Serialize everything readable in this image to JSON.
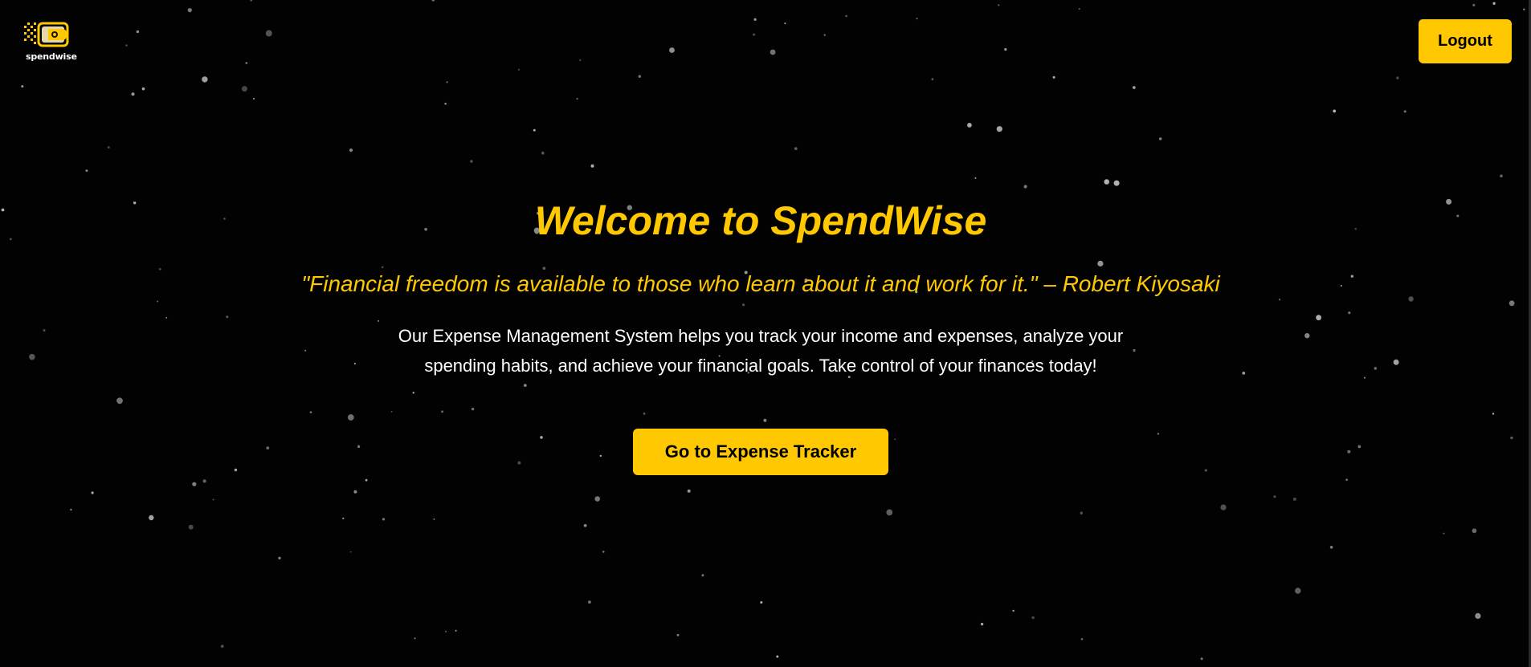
{
  "brand": {
    "name": "spendwise",
    "logo_icon": "wallet-icon"
  },
  "header": {
    "logout_label": "Logout"
  },
  "hero": {
    "title": "Welcome to SpendWise",
    "quote": "\"Financial freedom is available to those who learn about it and work for it.\" – Robert Kiyosaki",
    "description": "Our Expense Management System helps you track your income and expenses, analyze your spending habits, and achieve your financial goals. Take control of your finances today!",
    "cta_label": "Go to Expense Tracker"
  },
  "colors": {
    "background": "#020202",
    "accent": "#ffc800",
    "text_primary": "#ffffff",
    "button_text": "#000000",
    "star": "#9a9a9a"
  }
}
